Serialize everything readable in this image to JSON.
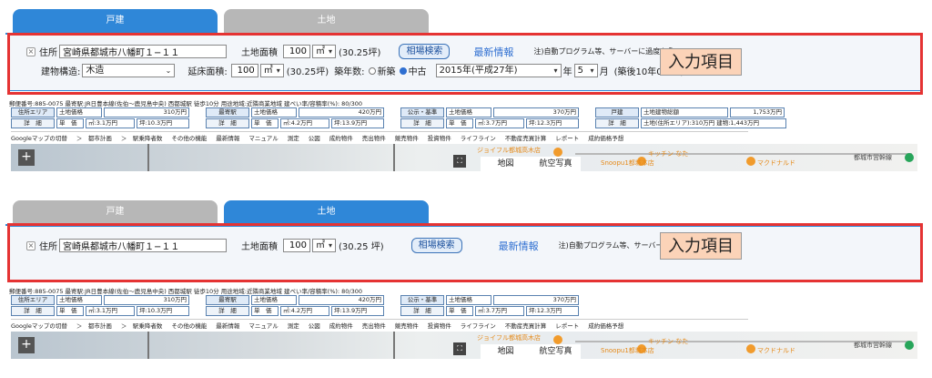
{
  "panel1": {
    "tabs": [
      {
        "label": "戸建",
        "active": true
      },
      {
        "label": "土地",
        "active": false
      }
    ],
    "address_label": "住所",
    "address_value": "宮崎県都城市八幡町１−１１",
    "land_area_label": "土地面積",
    "land_area_value": "100",
    "area_unit": "㎡",
    "land_tsubo": "(30.25坪)",
    "soba_button": "相場検索",
    "news_link": "最新情報",
    "notice": "注)自動プログラム等、サーバーに過度な負",
    "structure_label": "建物構造:",
    "structure_value": "木造",
    "floor_area_label": "延床面積:",
    "floor_area_value": "100",
    "floor_unit": "㎡",
    "floor_tsubo": "(30.25坪)",
    "age_label": "築年数:",
    "new_label": "新築",
    "used_label": "中古",
    "year_value": "2015年(平成27年)",
    "year_suffix": "年",
    "month_value": "5",
    "month_suffix": "月",
    "age_result": "(築後10年0ヶ月)",
    "callout": "入力項目",
    "info_line": "郵便番号:885-0075 最寄駅:JR日豊本線(佐伯〜鹿児島中央) 西都城駅 徒歩10分 用途地域:近隣商業地域 建ぺい率/容積率(%): 80/300",
    "cells": {
      "a_head": "住所エリア",
      "a_land": "土地価格",
      "a_price": "310万円",
      "a_btn": "詳　細",
      "a_unit": "単　価",
      "a_m2": "㎡:3.1万円",
      "a_tsubo": "坪:10.3万円",
      "b_head": "最寄駅",
      "b_land": "土地価格",
      "b_price": "420万円",
      "b_btn": "詳　細",
      "b_unit": "単　価",
      "b_m2": "㎡:4.2万円",
      "b_tsubo": "坪:13.9万円",
      "c_head": "公示・基準",
      "c_land": "土地価格",
      "c_price": "370万円",
      "c_btn": "詳　細",
      "c_unit": "単　価",
      "c_m2": "㎡:3.7万円",
      "c_tsubo": "坪:12.3万円",
      "d_head": "戸建",
      "d_total": "土地建物総額",
      "d_price": "1,753万円",
      "d_btn": "詳　細",
      "d_detail": "土地(住所エリア):310万円 建物:1,443万円"
    }
  },
  "panel2": {
    "tabs": [
      {
        "label": "戸建",
        "active": false
      },
      {
        "label": "土地",
        "active": true
      }
    ],
    "address_label": "住所",
    "address_value": "宮崎県都城市八幡町１−１１",
    "land_area_label": "土地面積",
    "land_area_value": "100",
    "area_unit": "㎡",
    "land_tsubo": "(30.25 坪)",
    "soba_button": "相場検索",
    "news_link": "最新情報",
    "notice": "注)自動プログラム等、サーバーに過度な負",
    "callout": "入力項目",
    "info_line": "郵便番号:885-0075 最寄駅:JR日豊本線(佐伯〜鹿児島中央) 西都城駅 徒歩10分 用途地域:近隣商業地域 建ぺい率/容積率(%): 80/300",
    "cells": {
      "a_head": "住所エリア",
      "a_land": "土地価格",
      "a_price": "310万円",
      "a_btn": "詳　細",
      "a_unit": "単　価",
      "a_m2": "㎡:3.1万円",
      "a_tsubo": "坪:10.3万円",
      "b_head": "最寄駅",
      "b_land": "土地価格",
      "b_price": "420万円",
      "b_btn": "詳　細",
      "b_unit": "単　価",
      "b_m2": "㎡:4.2万円",
      "b_tsubo": "坪:13.9万円",
      "c_head": "公示・基準",
      "c_land": "土地価格",
      "c_price": "370万円",
      "c_btn": "詳　細",
      "c_unit": "単　価",
      "c_m2": "㎡:3.7万円",
      "c_tsubo": "坪:12.3万円"
    }
  },
  "menu": [
    "Googleマップの切替",
    "＞　都市計画",
    "＞　駅乗降者数",
    "その他の機能",
    "最新情報",
    "マニュアル",
    "測定",
    "公図",
    "成約物件",
    "売出物件",
    "競売物件",
    "投資物件",
    "ライフライン",
    "不動産売買計算",
    "レポート",
    "成約価格予想"
  ],
  "map": {
    "zoom": "+",
    "map_btn": "地図",
    "satellite_btn": "航空写真",
    "label_a": "ジョイフル都城高木店",
    "label_b": "Snoopu1都城本店",
    "label_c": "キッチン なた",
    "label_d": "マクドナルド",
    "label_e": "都城市営幹線"
  },
  "colors": {
    "accent": "#2f87d8",
    "highlight": "#e53333",
    "callout_bg": "#fbd3b8"
  }
}
